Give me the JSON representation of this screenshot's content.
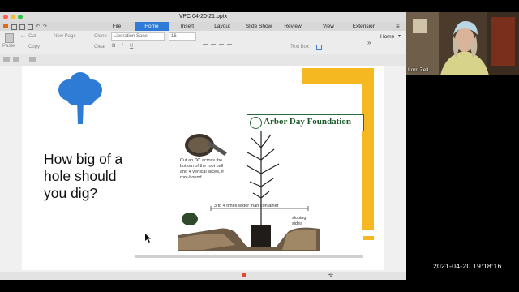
{
  "window": {
    "title": "VPC 04-20-21.pptx"
  },
  "menu": {
    "items": [
      "File",
      "Home",
      "Insert",
      "Layout",
      "Slide Show",
      "Review",
      "View",
      "Extension"
    ],
    "active": "Home",
    "hamburger_icon": "menu-icon"
  },
  "toolbar": {
    "paste": "Paste",
    "cut": "Cut",
    "copy": "Copy",
    "new_page": "New Page",
    "clone": "Clone",
    "clear": "Clear",
    "font_name": "Liberation Sans",
    "font_size": "16",
    "bold": "B",
    "italic": "I",
    "underline": "U",
    "text_box": "Text Box",
    "home_tab": "Home"
  },
  "slide": {
    "heading": "How big of a hole should you dig?",
    "brand": "Arbor Day Foundation",
    "callout": "Cut an \"X\" across the bottom of the root ball and 4 vertical slices, if root-bound.",
    "width_label": "3 to 4 times wider than container",
    "slope_label": "sloping sides",
    "tree_icon": "tree-icon",
    "accent_color": "#f5b820",
    "tree_color": "#2e7bd6"
  },
  "video": {
    "participant_name": "Lorri Zell"
  },
  "timestamp": "2021-04-20  19:18:16"
}
